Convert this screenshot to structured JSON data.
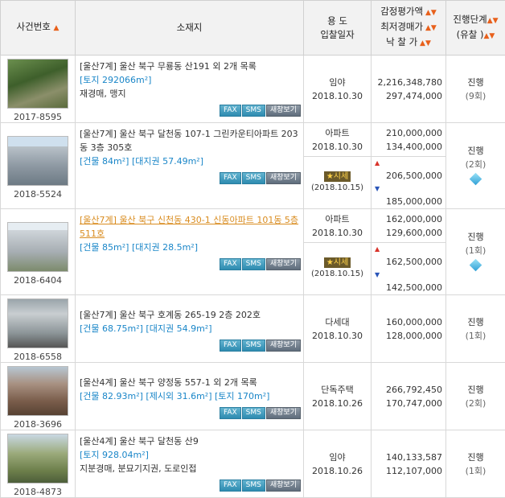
{
  "header": {
    "case_no": "사건번호",
    "location": "소재지",
    "use_line1": "용 도",
    "use_line2": "입찰일자",
    "price_line1": "감정평가액",
    "price_line2": "최저경매가",
    "price_line3": "낙 찰 가",
    "status_line1": "진행단계",
    "status_line2": "(유찰 )"
  },
  "buttons": {
    "fax": "FAX",
    "sms": "SMS",
    "detail": "새창보기"
  },
  "rows": [
    {
      "case": "2017-8595",
      "addr": "[울산7계] 울산 북구 무룡동 산191 외 2개 목록",
      "area": "[토지 292066m²]",
      "note": "재경매, 맹지",
      "use": "임야",
      "date": "2018.10.30",
      "appraisal": "2,216,348,780",
      "minimum": "297,474,000",
      "status": "진행",
      "count": "(9회)"
    },
    {
      "case": "2018-5524",
      "addr": "[울산7계] 울산 북구 달천동 107-1 그린카운티아파트 203동 3층 305호",
      "area": "[건물 84m²] [대지권 57.49m²]",
      "use": "아파트",
      "date": "2018.10.30",
      "appraisal": "210,000,000",
      "minimum": "134,400,000",
      "status": "진행",
      "count": "(2회)",
      "market_label": "시세",
      "market_date": "(2018.10.15)",
      "market_high": "206,500,000",
      "market_low": "185,000,000"
    },
    {
      "case": "2018-6404",
      "addr": "[울산7계] 울산 북구 신천동 430-1 신동아파트 101동 5층 511호",
      "area": "[건물 85m²] [대지권 28.5m²]",
      "use": "아파트",
      "date": "2018.10.30",
      "appraisal": "162,000,000",
      "minimum": "129,600,000",
      "status": "진행",
      "count": "(1회)",
      "market_label": "시세",
      "market_date": "(2018.10.15)",
      "market_high": "162,500,000",
      "market_low": "142,500,000"
    },
    {
      "case": "2018-6558",
      "addr": "[울산7계] 울산 북구 호계동 265-19 2층 202호",
      "area": "[건물 68.75m²] [대지권 54.9m²]",
      "use": "다세대",
      "date": "2018.10.30",
      "appraisal": "160,000,000",
      "minimum": "128,000,000",
      "status": "진행",
      "count": "(1회)"
    },
    {
      "case": "2018-3696",
      "addr": "[울산4계] 울산 북구 양정동 557-1 외 2개 목록",
      "area": "[건물 82.93m²] [제시외 31.6m²] [토지 170m²]",
      "use": "단독주택",
      "date": "2018.10.26",
      "appraisal": "266,792,450",
      "minimum": "170,747,000",
      "status": "진행",
      "count": "(2회)"
    },
    {
      "case": "2018-4873",
      "addr": "[울산4계] 울산 북구 달천동 산9",
      "area": "[토지 928.04m²]",
      "note": "지분경매, 분묘기지권, 도로인접",
      "use": "임야",
      "date": "2018.10.26",
      "appraisal": "140,133,587",
      "minimum": "112,107,000",
      "status": "진행",
      "count": "(1회)"
    }
  ]
}
